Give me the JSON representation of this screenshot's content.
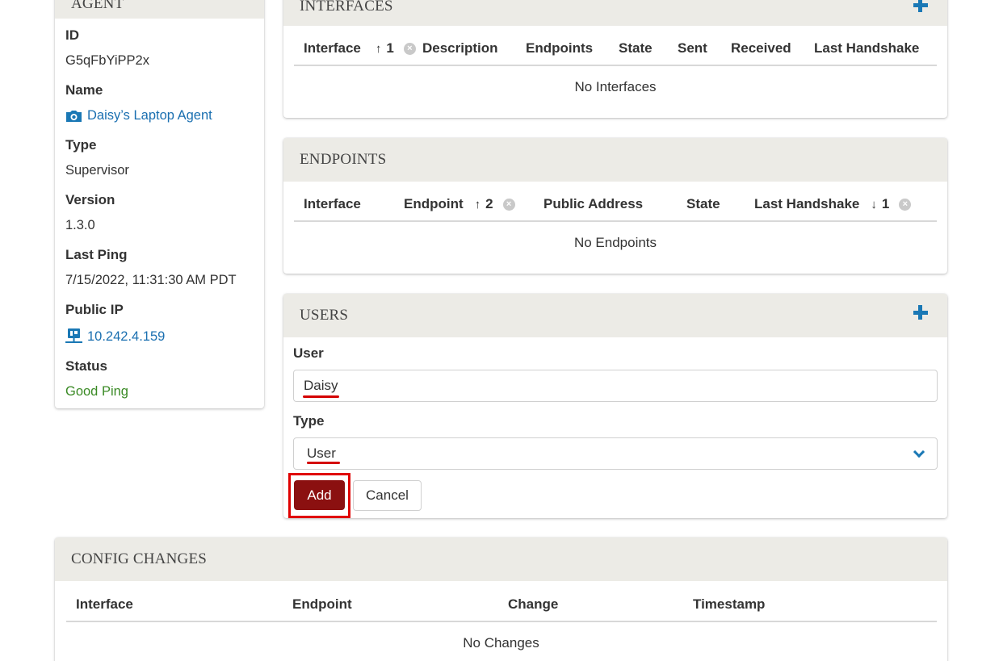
{
  "agent": {
    "title": "AGENT",
    "fields": [
      {
        "label": "ID",
        "value": "G5qFbYiPP2x"
      },
      {
        "label": "Name",
        "value": "Daisy’s Laptop Agent"
      },
      {
        "label": "Type",
        "value": "Supervisor"
      },
      {
        "label": "Version",
        "value": "1.3.0"
      },
      {
        "label": "Last Ping",
        "value": "7/15/2022, 11:31:30 AM PDT"
      },
      {
        "label": "Public IP",
        "value": "10.242.4.159"
      },
      {
        "label": "Status",
        "value": "Good Ping"
      }
    ]
  },
  "interfaces": {
    "title": "INTERFACES",
    "columns": [
      "Interface",
      "Description",
      "Endpoints",
      "State",
      "Sent",
      "Received",
      "Last Handshake"
    ],
    "sort": {
      "arrow": "↑",
      "index": "1"
    },
    "empty": "No Interfaces"
  },
  "endpoints": {
    "title": "ENDPOINTS",
    "columns": [
      "Interface",
      "Endpoint",
      "Public Address",
      "State",
      "Last Handshake"
    ],
    "sort_endpoint": {
      "arrow": "↑",
      "index": "2"
    },
    "sort_handshake": {
      "arrow": "↓",
      "index": "1"
    },
    "empty": "No Endpoints"
  },
  "users": {
    "title": "USERS",
    "user_label": "User",
    "user_value": "Daisy",
    "type_label": "Type",
    "type_value": "User",
    "add_label": "Add",
    "cancel_label": "Cancel"
  },
  "config": {
    "title": "CONFIG CHANGES",
    "columns": [
      "Interface",
      "Endpoint",
      "Change",
      "Timestamp"
    ],
    "empty": "No Changes"
  },
  "colors": {
    "accent": "#1a78b5",
    "danger": "#8b1010",
    "good": "#3a8a25",
    "header_bg": "#ecebe6"
  },
  "icons": {
    "agent_header": "gear-icon",
    "name_link": "camera-icon",
    "public_ip": "network-icon",
    "add": "plus-icon",
    "select": "chevron-down-icon"
  }
}
